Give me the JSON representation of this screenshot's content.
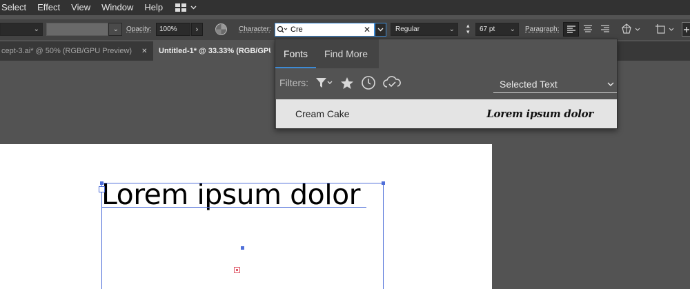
{
  "menu": {
    "items": [
      "Select",
      "Effect",
      "View",
      "Window",
      "Help"
    ]
  },
  "control_bar": {
    "opacity_label": "Opacity:",
    "opacity_value": "100%",
    "character_label": "Character:",
    "font_search_value": "Cre",
    "font_style": "Regular",
    "font_size": "67 pt",
    "paragraph_label": "Paragraph:"
  },
  "tabs": [
    {
      "label": "cept-3.ai* @ 50% (RGB/GPU Preview)"
    },
    {
      "label": "Untitled-1* @ 33.33% (RGB/GPU"
    }
  ],
  "font_panel": {
    "tabs": [
      "Fonts",
      "Find More"
    ],
    "filters_label": "Filters:",
    "preview_mode": "Selected Text",
    "results": [
      {
        "name": "Cream Cake",
        "preview": "Lorem ipsum dolor"
      }
    ]
  },
  "canvas": {
    "text": "Lorem ipsum dolor"
  },
  "colors": {
    "accent": "#3d8bd6",
    "selection": "#4f6fd9",
    "ui_dark": "#323232",
    "ui_mid": "#535353"
  }
}
